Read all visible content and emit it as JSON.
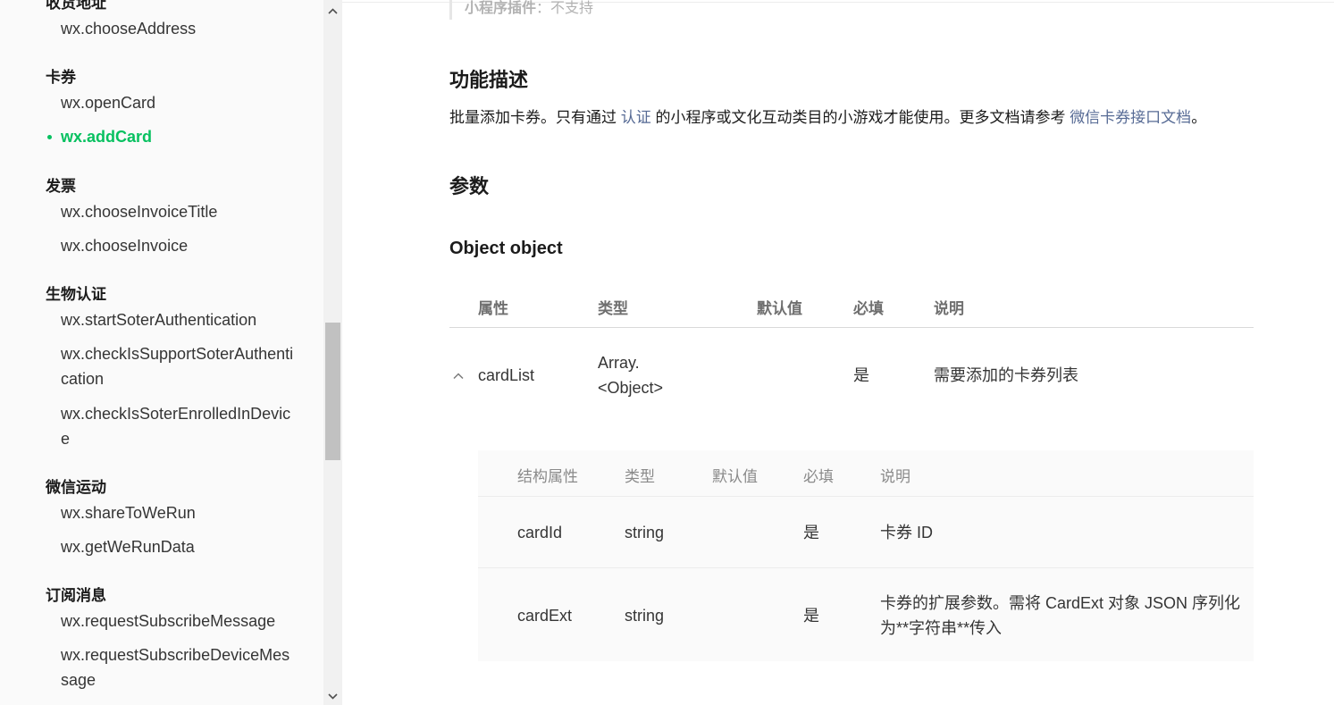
{
  "sidebar": {
    "top_partial_title": "收货地址",
    "groups": [
      {
        "title": "",
        "items": [
          "wx.chooseAddress"
        ]
      },
      {
        "title": "卡券",
        "items": [
          "wx.openCard",
          "wx.addCard"
        ]
      },
      {
        "title": "发票",
        "items": [
          "wx.chooseInvoiceTitle",
          "wx.chooseInvoice"
        ]
      },
      {
        "title": "生物认证",
        "items": [
          "wx.startSoterAuthentication",
          "wx.checkIsSupportSoterAuthentication",
          "wx.checkIsSoterEnrolledInDevice"
        ]
      },
      {
        "title": "微信运动",
        "items": [
          "wx.shareToWeRun",
          "wx.getWeRunData"
        ]
      },
      {
        "title": "订阅消息",
        "items": [
          "wx.requestSubscribeMessage",
          "wx.requestSubscribeDeviceMessage"
        ]
      }
    ],
    "active_item": "wx.addCard"
  },
  "main": {
    "plugin_label": "小程序插件",
    "plugin_value": "：不支持",
    "feature_title": "功能描述",
    "desc_part1": "批量添加卡券。只有通过 ",
    "desc_link1": "认证",
    "desc_part2": " 的小程序或文化互动类目的小游戏才能使用。更多文档请参考 ",
    "desc_link2": "微信卡券接口文档",
    "desc_part3": "。",
    "params_title": "参数",
    "object_title": "Object object",
    "param_table": {
      "headers": {
        "attr": "属性",
        "type": "类型",
        "default": "默认值",
        "required": "必填",
        "desc": "说明"
      },
      "row": {
        "name": "cardList",
        "type_line1": "Array.",
        "type_line2": "<Object>",
        "default": "",
        "required": "是",
        "desc": "需要添加的卡券列表"
      }
    },
    "sub_table": {
      "headers": {
        "attr": "结构属性",
        "type": "类型",
        "default": "默认值",
        "required": "必填",
        "desc": "说明"
      },
      "rows": [
        {
          "name": "cardId",
          "type": "string",
          "default": "",
          "required": "是",
          "desc_line1": "卡券 ID",
          "desc_line2": ""
        },
        {
          "name": "cardExt",
          "type": "string",
          "default": "",
          "required": "是",
          "desc_line1": "卡券的扩展参数。需将 CardExt 对象 JSON 序列化",
          "desc_line2": "为**字符串**传入"
        }
      ]
    }
  },
  "colors": {
    "accent_green": "#07c160",
    "link_blue": "#576b95"
  }
}
